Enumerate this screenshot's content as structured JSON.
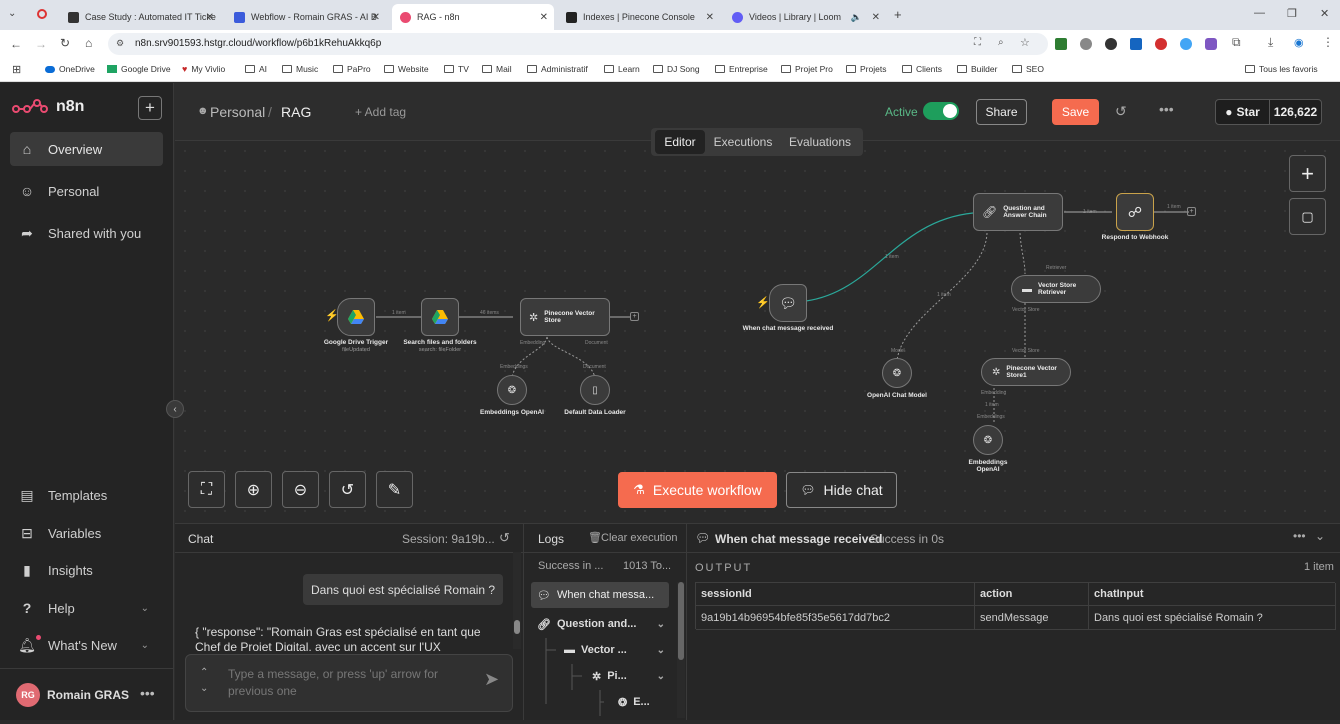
{
  "browser": {
    "tabs": [
      {
        "title": "Case Study : Automated IT Ticke",
        "color": "#333"
      },
      {
        "title": "Webflow - Romain GRAS - AI B",
        "color": "#3b5bdb"
      },
      {
        "title": "RAG - n8n",
        "color": "#ea4b71"
      },
      {
        "title": "Indexes | Pinecone Console",
        "color": "#222"
      },
      {
        "title": "Videos | Library | Loom",
        "color": "#625df5"
      }
    ],
    "url": "n8n.srv901593.hstgr.cloud/workflow/p6b1kRehuAkkq6p",
    "bookmarks": [
      "OneDrive",
      "Google Drive",
      "My Vivlio",
      "AI",
      "Music",
      "PaPro",
      "Website",
      "TV",
      "Mail",
      "Administratif",
      "Learn",
      "DJ Song",
      "Entreprise",
      "Projet Pro",
      "Projets",
      "Clients",
      "Builder",
      "SEO"
    ],
    "all_bookmarks": "Tous les favoris"
  },
  "sidebar": {
    "brand": "n8n",
    "items": [
      {
        "label": "Overview",
        "icon": "home-icon"
      },
      {
        "label": "Personal",
        "icon": "user-icon"
      },
      {
        "label": "Shared with you",
        "icon": "share-icon"
      }
    ],
    "bottom": [
      {
        "label": "Templates",
        "icon": "templates-icon"
      },
      {
        "label": "Variables",
        "icon": "variables-icon"
      },
      {
        "label": "Insights",
        "icon": "insights-icon"
      },
      {
        "label": "Help",
        "icon": "help-icon"
      },
      {
        "label": "What's New",
        "icon": "whats-new-icon"
      }
    ],
    "user": {
      "initials": "RG",
      "name": "Romain GRAS"
    }
  },
  "header": {
    "project": "Personal",
    "workflow": "RAG",
    "add_tag": "+ Add tag",
    "active_label": "Active",
    "share": "Share",
    "save": "Save",
    "star": "Star",
    "star_count": "126,622",
    "tabs": [
      "Editor",
      "Executions",
      "Evaluations"
    ]
  },
  "canvas": {
    "nodes": {
      "gdrive_trigger": {
        "label": "Google Drive Trigger",
        "sub": "fileUpdated"
      },
      "search_files": {
        "label": "Search files and folders",
        "sub": "search: fileFolder"
      },
      "pinecone_store": {
        "label": "Pinecone Vector Store"
      },
      "embeddings_openai": {
        "label": "Embeddings OpenAI"
      },
      "data_loader": {
        "label": "Default Data Loader"
      },
      "chat_trigger": {
        "label": "When chat message received"
      },
      "qa_chain": {
        "label": "Question and Answer Chain"
      },
      "respond_webhook": {
        "label": "Respond to Webhook"
      },
      "retriever": {
        "label": "Vector Store Retriever"
      },
      "chat_model": {
        "label": "OpenAI Chat Model"
      },
      "pinecone_store1": {
        "label": "Pinecone Vector Store1"
      },
      "embeddings_openai2": {
        "label": "Embeddings OpenAI"
      }
    },
    "edge_labels": {
      "one_item": "1 item",
      "items46": "46 items",
      "embedding": "Embedding",
      "embeddings": "Embeddings",
      "document": "Document",
      "model": "Model",
      "retriever": "Retriever",
      "vector_store": "Vector Store"
    },
    "execute": "Execute workflow",
    "hide_chat": "Hide chat"
  },
  "chat": {
    "title": "Chat",
    "session": "Session: 9a19b...",
    "user_message": "Dans quoi est spécialisé Romain ?",
    "bot_message": "{ \"response\": \"Romain Gras est spécialisé en tant que Chef de Projet Digital, avec un accent sur l'UX",
    "input_placeholder": "Type a message, or press 'up' arrow for previous one"
  },
  "logs": {
    "title": "Logs",
    "clear": "Clear execution",
    "status": "Success in ...",
    "tokens": "1013 To...",
    "tree": [
      {
        "label": "When chat messa...",
        "icon": "chat-icon",
        "level": 0
      },
      {
        "label": "Question and...",
        "icon": "link-icon",
        "level": 0
      },
      {
        "label": "Vector ...",
        "icon": "retriever-icon",
        "level": 1
      },
      {
        "label": "Pi...",
        "icon": "pinecone-icon",
        "level": 2
      },
      {
        "label": "E...",
        "icon": "openai-icon",
        "level": 3
      }
    ]
  },
  "output": {
    "node": "When chat message received",
    "status": "Success in 0s",
    "label": "OUTPUT",
    "count": "1 item",
    "columns": [
      "sessionId",
      "action",
      "chatInput"
    ],
    "row": [
      "9a19b14b96954bfe85f35e5617dd7bc2",
      "sendMessage",
      "Dans quoi est spécialisé Romain ?"
    ]
  }
}
